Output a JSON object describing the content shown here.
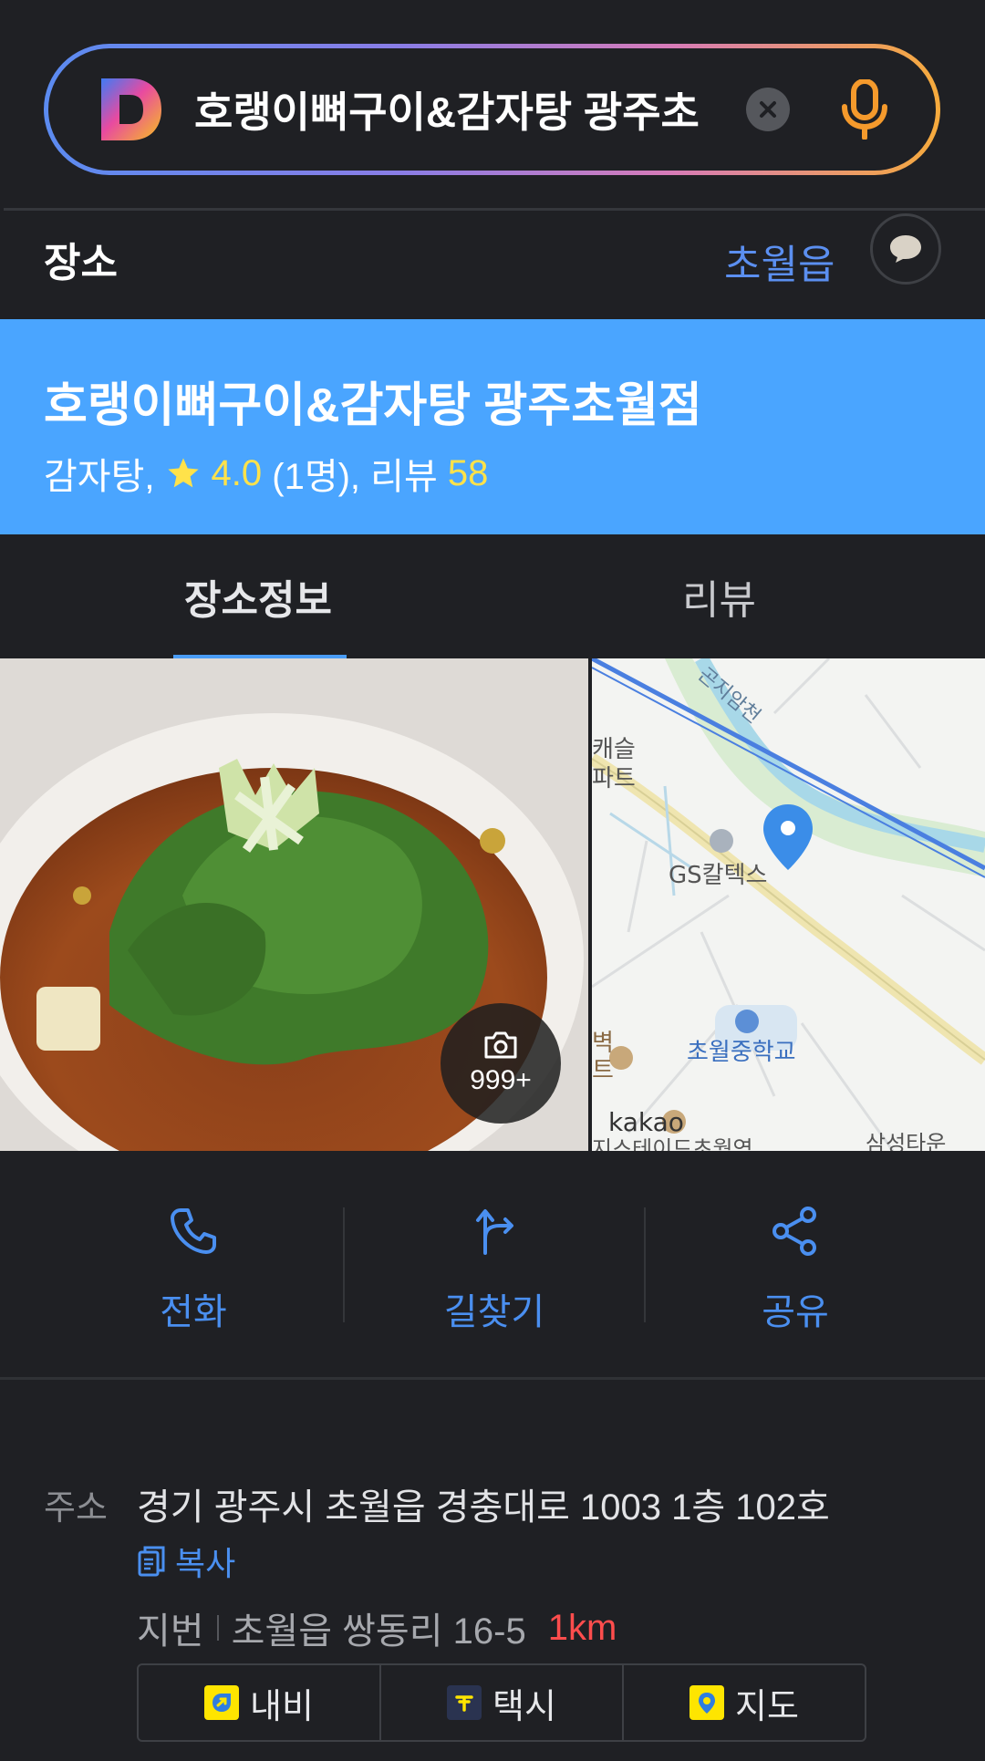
{
  "search": {
    "query": "호랭이뼈구이&감자탕 광주초",
    "logo_letter": "D"
  },
  "section": {
    "title": "장소",
    "location_filter": "초월읍"
  },
  "place": {
    "name": "호랭이뼈구이&감자탕 광주초월점",
    "category": "감자탕,",
    "rating": "4.0",
    "rating_count": "(1명), 리뷰",
    "review_count": "58"
  },
  "tabs": [
    {
      "label": "장소정보",
      "active": true
    },
    {
      "label": "리뷰",
      "active": false
    }
  ],
  "photo": {
    "count": "999+"
  },
  "map": {
    "labels": [
      "곤지암천",
      "캐슬",
      "파트",
      "GS칼텍스",
      "초월중학교",
      "kakao",
      "삼성타운",
      "벽",
      "트",
      "지스테이드초월역"
    ]
  },
  "actions": [
    {
      "label": "전화",
      "icon": "phone-icon"
    },
    {
      "label": "길찾기",
      "icon": "directions-icon"
    },
    {
      "label": "공유",
      "icon": "share-icon"
    }
  ],
  "address": {
    "label": "주소",
    "road": "경기 광주시 초월읍 경충대로 1003 1층 102호",
    "copy_label": "복사",
    "lot_label": "지번",
    "lot": "초월읍 쌍동리 16-5",
    "distance": "1km"
  },
  "link_buttons": [
    {
      "label": "내비",
      "icon": "navi-icon"
    },
    {
      "label": "택시",
      "icon": "taxi-icon"
    },
    {
      "label": "지도",
      "icon": "map-pin-icon"
    }
  ],
  "colors": {
    "background": "#1f2024",
    "banner": "#4aa5ff",
    "accent_blue": "#4a8ff0",
    "rating_yellow": "#ffe24a",
    "distance_red": "#ff4d4d",
    "kakao_yellow": "#fee500"
  }
}
